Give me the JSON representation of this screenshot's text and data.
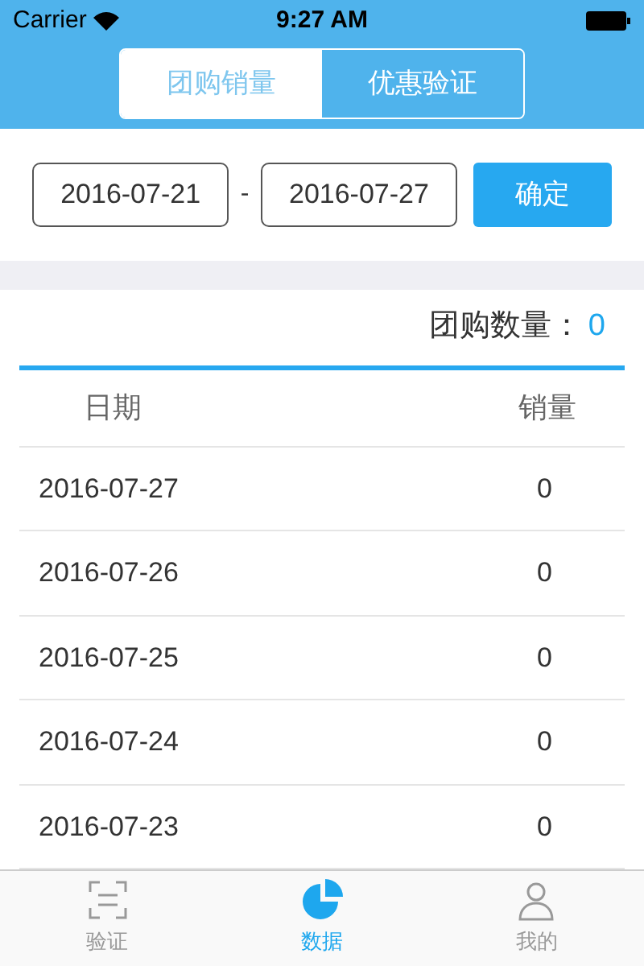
{
  "status_bar": {
    "carrier": "Carrier",
    "time": "9:27 AM"
  },
  "segments": [
    {
      "label": "团购销量",
      "selected": true
    },
    {
      "label": "优惠验证",
      "selected": false
    }
  ],
  "date_range": {
    "start": "2016-07-21",
    "separator": "-",
    "end": "2016-07-27",
    "confirm": "确定"
  },
  "summary": {
    "label": "团购数量：",
    "value": "0"
  },
  "table": {
    "columns": [
      "日期",
      "销量"
    ],
    "rows": [
      [
        "2016-07-27",
        "0"
      ],
      [
        "2016-07-26",
        "0"
      ],
      [
        "2016-07-25",
        "0"
      ],
      [
        "2016-07-24",
        "0"
      ],
      [
        "2016-07-23",
        "0"
      ]
    ]
  },
  "tab_bar": [
    {
      "label": "验证",
      "kind": "scan",
      "selected": false
    },
    {
      "label": "数据",
      "kind": "chart",
      "selected": true
    },
    {
      "label": "我的",
      "kind": "person",
      "selected": false
    }
  ]
}
